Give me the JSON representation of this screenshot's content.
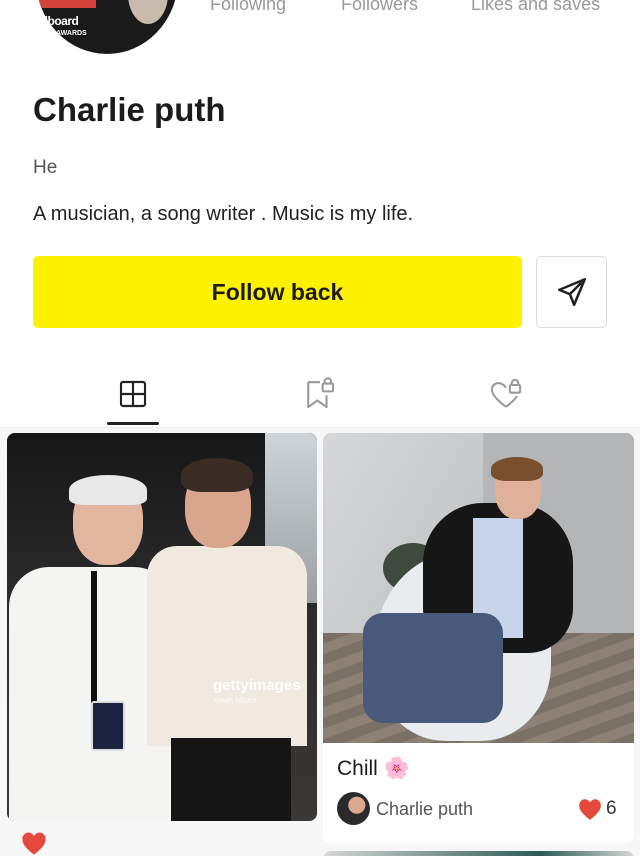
{
  "profile": {
    "avatar_badge_text": "illboard",
    "avatar_badge_sub": "AWARDS",
    "name": "Charlie puth",
    "pronoun": "He",
    "bio": "A musician, a song writer . Music is my life."
  },
  "stats": {
    "following_label": "Following",
    "followers_label": "Followers",
    "likes_label": "Likes and saves"
  },
  "actions": {
    "follow_label": "Follow back",
    "send_icon": "paper-plane-icon"
  },
  "tabs": [
    {
      "icon": "posts-grid-icon",
      "active": true
    },
    {
      "icon": "saved-locked-icon",
      "active": false
    },
    {
      "icon": "liked-locked-icon",
      "active": false
    }
  ],
  "posts": [
    {
      "watermark": "gettyimages",
      "watermark_credit": "Kevin Mazur",
      "like_icon": "heart-icon"
    },
    {
      "title": "Chill 🌸",
      "author": "Charlie puth",
      "likes": "6",
      "like_icon": "heart-icon",
      "like_color": "#e5483d"
    }
  ],
  "colors": {
    "accent": "#fff200",
    "heart": "#e5483d"
  }
}
